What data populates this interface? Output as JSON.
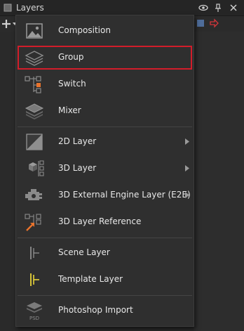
{
  "panel": {
    "title": "Layers",
    "icons": {
      "panel": "layers-panel-icon",
      "visibility": "eye-icon",
      "pin": "pin-icon",
      "close": "close-icon",
      "add": "add-layer-dropdown-icon"
    }
  },
  "menu": {
    "items": [
      {
        "label": "Composition",
        "icon": "composition-icon",
        "submenu": false
      },
      {
        "label": "Group",
        "icon": "group-icon",
        "submenu": false,
        "selected": true
      },
      {
        "label": "Switch",
        "icon": "switch-icon",
        "submenu": false
      },
      {
        "label": "Mixer",
        "icon": "mixer-icon",
        "submenu": false
      },
      {
        "label": "2D Layer",
        "icon": "2d-layer-icon",
        "submenu": true
      },
      {
        "label": "3D Layer",
        "icon": "3d-layer-icon",
        "submenu": true
      },
      {
        "label": "3D External Engine Layer (E2E)",
        "icon": "e2e-engine-icon",
        "submenu": true
      },
      {
        "label": "3D Layer Reference",
        "icon": "3d-layer-reference-icon",
        "submenu": false
      },
      {
        "label": "Scene Layer",
        "icon": "scene-layer-icon",
        "submenu": false
      },
      {
        "label": "Template Layer",
        "icon": "template-layer-icon",
        "submenu": false
      },
      {
        "label": "Photoshop Import",
        "icon": "photoshop-import-icon",
        "submenu": false,
        "badge": "PSD"
      }
    ]
  },
  "colors": {
    "selection_outline": "#d21d2a",
    "accent_orange": "#e9732c",
    "accent_yellow": "#e8d33a"
  }
}
